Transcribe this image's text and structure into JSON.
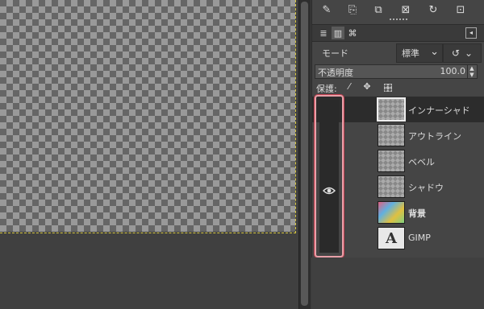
{
  "toolbar": {
    "icons": [
      "edit-icon",
      "new-layer-icon",
      "duplicate-icon",
      "delete-icon",
      "refresh-icon",
      "save-icon"
    ]
  },
  "tabs": [
    "layers-tab",
    "channels-tab",
    "paths-tab"
  ],
  "mode": {
    "label": "モード",
    "value": "標準"
  },
  "opacity": {
    "label": "不透明度",
    "value": "100.0"
  },
  "lock": {
    "label": "保護:"
  },
  "layers": [
    {
      "name": "インナーシャド",
      "selected": true
    },
    {
      "name": "アウトライン"
    },
    {
      "name": "ベベル"
    },
    {
      "name": "シャドウ"
    },
    {
      "name": "背景"
    },
    {
      "name": "GIMP"
    }
  ],
  "thumb_gimp_glyph": "A"
}
